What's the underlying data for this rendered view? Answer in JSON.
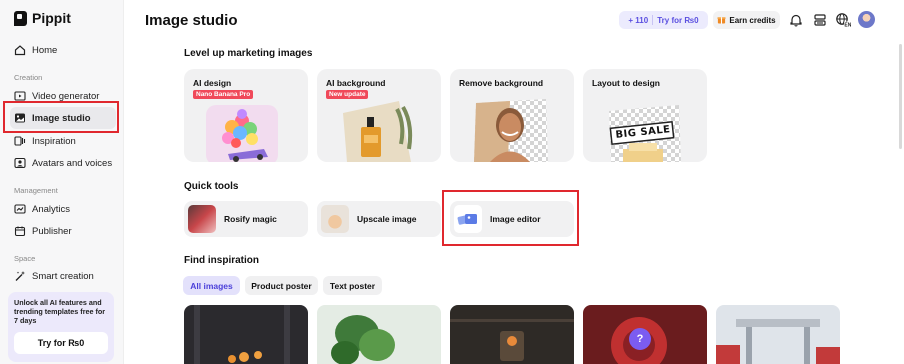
{
  "app": {
    "name": "Pippit"
  },
  "sidebar": {
    "home": "Home",
    "section_creation": "Creation",
    "creation_items": [
      "Video generator",
      "Image studio",
      "Inspiration",
      "Avatars and voices"
    ],
    "section_management": "Management",
    "management_items": [
      "Analytics",
      "Publisher"
    ],
    "section_space": "Space",
    "space_items": [
      "Smart creation"
    ],
    "promo_text": "Unlock all AI features and trending templates free for 7 days",
    "promo_button": "Try for ₨0"
  },
  "header": {
    "title": "Image studio",
    "credits": "+ 110",
    "credits_cta": "Try for ₨0",
    "earn": "Earn credits"
  },
  "main": {
    "section1": "Level up marketing images",
    "cards": [
      {
        "title": "AI design",
        "badge": "Nano Banana Pro"
      },
      {
        "title": "AI background",
        "badge": "New update"
      },
      {
        "title": "Remove background",
        "badge": ""
      },
      {
        "title": "Layout to design",
        "badge": "",
        "sign": "BIG SALE"
      }
    ],
    "section2": "Quick tools",
    "tools": [
      "Rosify magic",
      "Upscale image",
      "Image editor"
    ],
    "section3": "Find inspiration",
    "filters": [
      "All images",
      "Product poster",
      "Text poster"
    ]
  },
  "colors": {
    "accent": "#5a4fe0",
    "highlight": "#e0282e",
    "badge": "#f0495a"
  }
}
